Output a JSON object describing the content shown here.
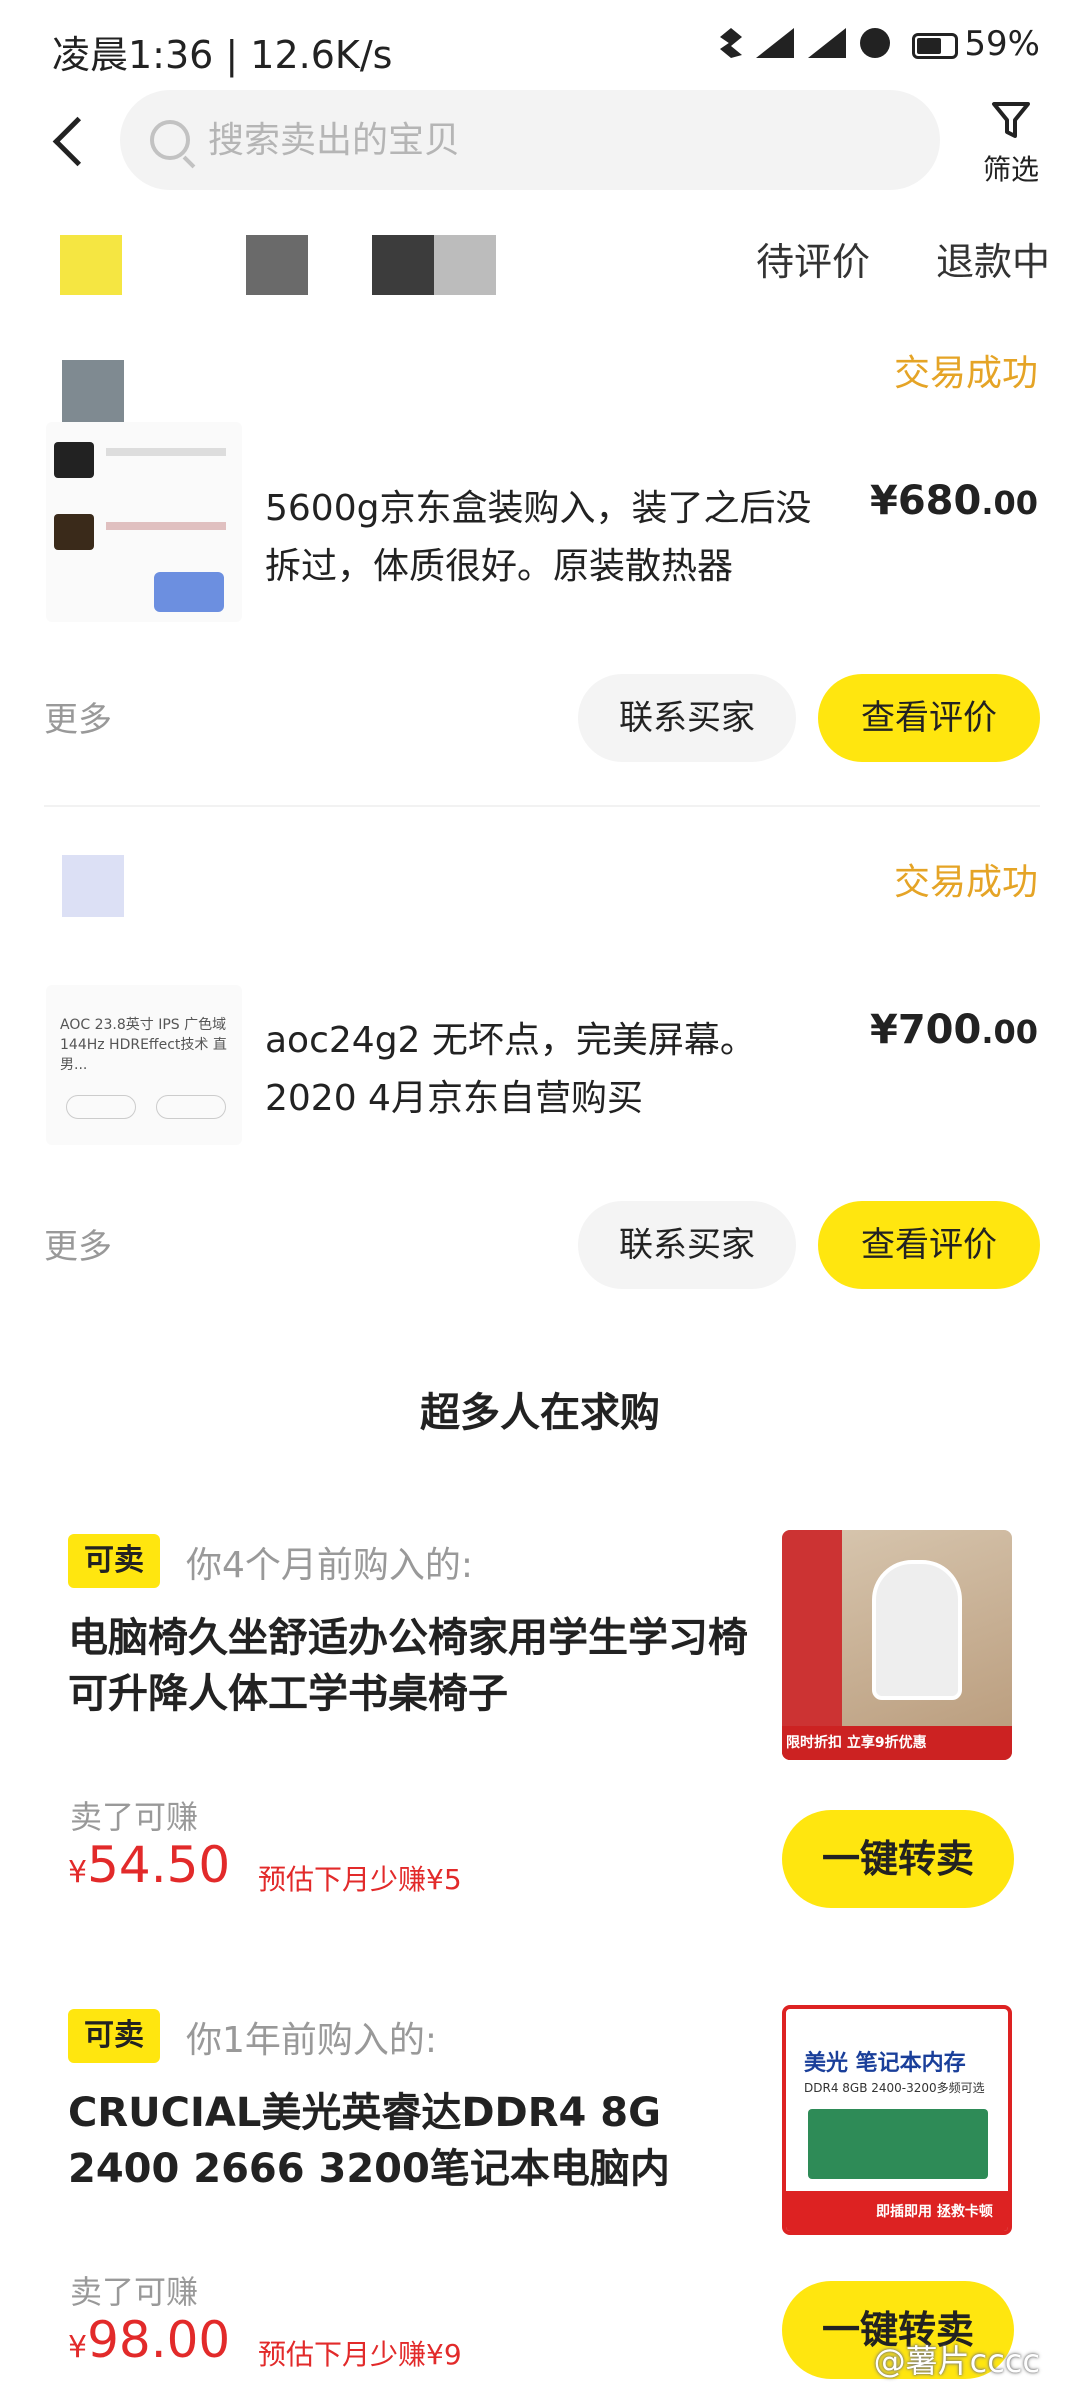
{
  "status_bar": {
    "time": "凌晨1:36 | 12.6K/s",
    "battery": "59%"
  },
  "search": {
    "placeholder": "搜索卖出的宝贝"
  },
  "filter": {
    "label": "筛选"
  },
  "tabs": {
    "pending_review": "待评价",
    "refunding": "退款中"
  },
  "orders": [
    {
      "status": "交易成功",
      "desc": "5600g京东盒装购入，装了之后没拆过，体质很好。原装散热器",
      "price_int": "¥680",
      "price_dec": ".00",
      "more": "更多",
      "contact": "联系买家",
      "review": "查看评价"
    },
    {
      "status": "交易成功",
      "desc": "aoc24g2 无坏点，完美屏幕。2020 4月京东自营购买",
      "price_int": "¥700",
      "price_dec": ".00",
      "more": "更多",
      "contact": "联系买家",
      "review": "查看评价",
      "thumb_text": "AOC 23.8英寸 IPS 广色域 144Hz HDREffect技术 直男..."
    }
  ],
  "section": {
    "title": "超多人在求购"
  },
  "recommendations": [
    {
      "tag": "可卖",
      "bought": "你4个月前购入的:",
      "title": "电脑椅久坐舒适办公椅家用学生学习椅可升降人体工学书桌椅子",
      "earn_label": "卖了可赚",
      "yen": "¥",
      "earn": "54.50",
      "estimate": "预估下月少赚¥5",
      "resell": "一键转卖",
      "img_text": "限时折扣 立享9折优惠"
    },
    {
      "tag": "可卖",
      "bought": "你1年前购入的:",
      "title": "CRUCIAL美光英睿达DDR4 8G 2400 2666 3200笔记本电脑内",
      "earn_label": "卖了可赚",
      "yen": "¥",
      "earn": "98.00",
      "estimate": "预估下月少赚¥9",
      "resell": "一键转卖",
      "img_title": "美光 笔记本内存",
      "img_sub": "DDR4 8GB 2400-3200多频可选",
      "img_footer": "即插即用 拯救卡顿"
    }
  ],
  "watermark": "@薯片cccc",
  "colors": {
    "accent": "#ffe60f",
    "success": "#e5a426",
    "earn": "#e22a2a"
  }
}
